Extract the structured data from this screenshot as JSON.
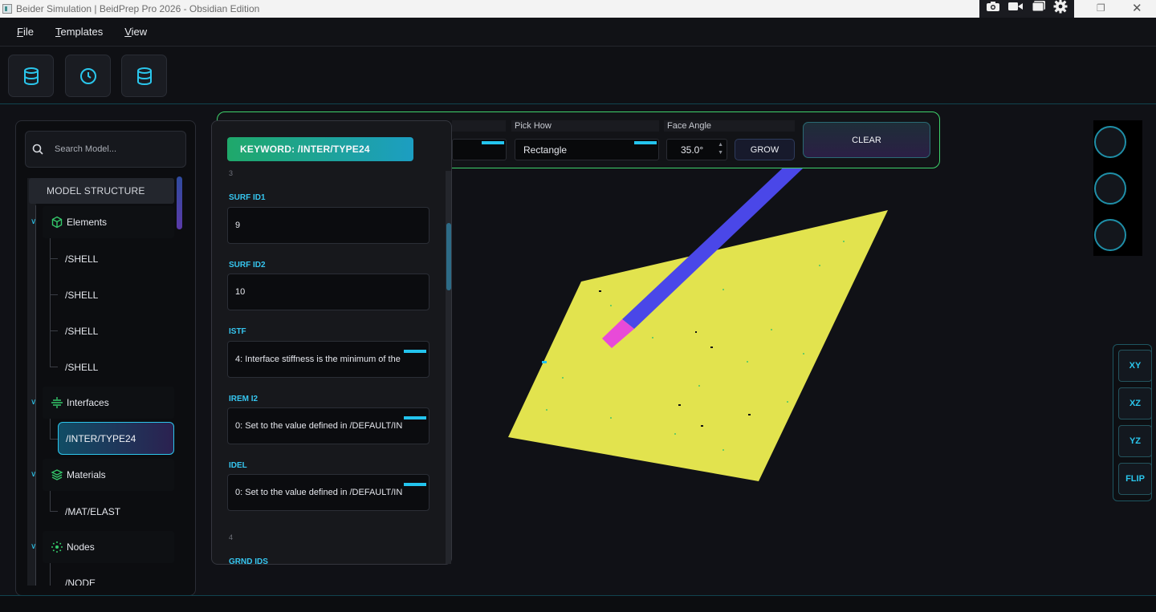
{
  "window": {
    "title": "Beider Simulation | BeidPrep Pro 2026 - Obsidian Edition",
    "tools": [
      "camera-icon",
      "video-icon",
      "window-icon",
      "gear-icon"
    ]
  },
  "menu": [
    "File",
    "Templates",
    "View"
  ],
  "toolbar": {
    "buttons": [
      "database-icon",
      "clock-icon",
      "database-icon"
    ]
  },
  "pickbar": {
    "pick_how_label": "Pick How",
    "pick_how_value": "Rectangle",
    "face_angle_label": "Face Angle",
    "face_angle_value": "35.0°",
    "grow_label": "GROW",
    "clear_label": "CLEAR"
  },
  "tree": {
    "search_placeholder": "Search Model...",
    "header": "MODEL STRUCTURE",
    "categories": [
      {
        "label": "Elements",
        "icon": "cube-icon",
        "children": [
          "/SHELL",
          "/SHELL",
          "/SHELL",
          "/SHELL"
        ]
      },
      {
        "label": "Interfaces",
        "icon": "interface-icon",
        "children": [
          "/INTER/TYPE24"
        ]
      },
      {
        "label": "Materials",
        "icon": "layers-icon",
        "children": [
          "/MAT/ELAST"
        ]
      },
      {
        "label": "Nodes",
        "icon": "nodes-icon",
        "children": [
          "/NODE"
        ]
      }
    ]
  },
  "keyword": {
    "title": "KEYWORD: /INTER/TYPE24",
    "line3": "3",
    "line4": "4",
    "fields": [
      {
        "label": "SURF ID1",
        "value": "9"
      },
      {
        "label": "SURF ID2",
        "value": "10"
      },
      {
        "label": "ISTF",
        "value": "4: Interface stiffness is the minimum of the"
      },
      {
        "label": "IREM I2",
        "value": "0: Set to the value defined in /DEFAULT/IN"
      },
      {
        "label": "IDEL",
        "value": "0: Set to the value defined in /DEFAULT/IN"
      }
    ],
    "next_label": "GRND IDS"
  },
  "view_buttons": [
    "XY",
    "XZ",
    "YZ",
    "FLIP"
  ],
  "colors": {
    "accent": "#23c4ee",
    "plane": "#e2e34e",
    "beam": "#4a47e8",
    "beam_tip": "#e84ad8",
    "highlight_border": "#3ed26b"
  }
}
